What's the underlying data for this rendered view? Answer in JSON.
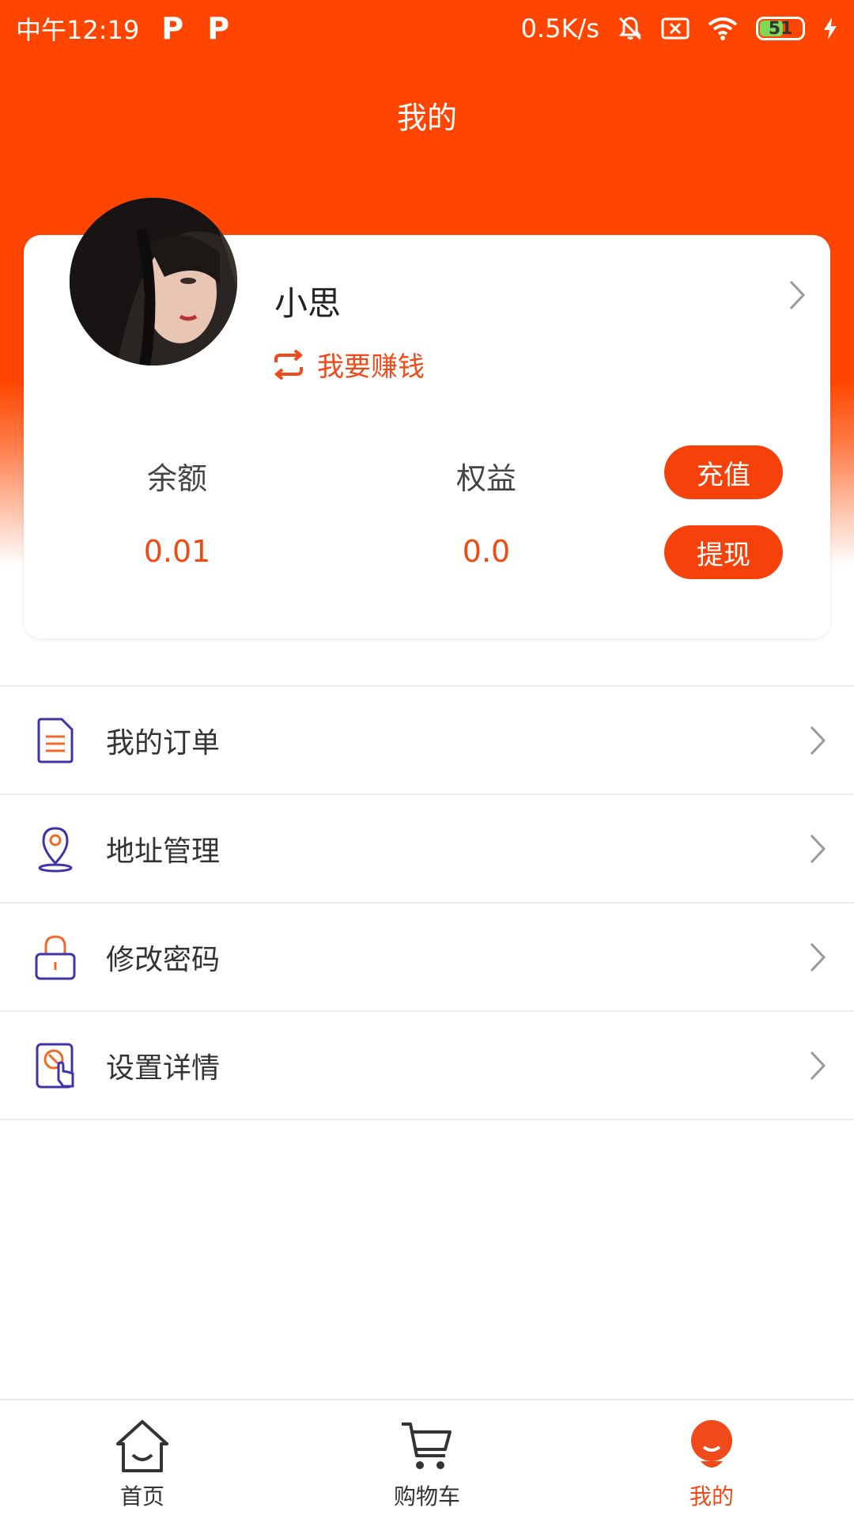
{
  "status_bar": {
    "time": "中午12:19",
    "network_speed": "0.5K/s",
    "battery_level": "51"
  },
  "header": {
    "title": "我的"
  },
  "profile": {
    "name": "小思",
    "earn_label": "我要赚钱"
  },
  "stats": {
    "balance_label": "余额",
    "balance_value": "0.01",
    "equity_label": "权益",
    "equity_value": "0.0",
    "recharge_label": "充值",
    "withdraw_label": "提现"
  },
  "menu": {
    "items": [
      {
        "label": "我的订单",
        "icon": "order-document-icon"
      },
      {
        "label": "地址管理",
        "icon": "location-pin-icon"
      },
      {
        "label": "修改密码",
        "icon": "lock-icon"
      },
      {
        "label": "设置详情",
        "icon": "settings-touch-icon"
      }
    ]
  },
  "tab_bar": {
    "tabs": [
      {
        "label": "首页",
        "icon": "home-icon"
      },
      {
        "label": "购物车",
        "icon": "cart-icon"
      },
      {
        "label": "我的",
        "icon": "profile-face-icon"
      }
    ],
    "active_index": 2
  },
  "colors": {
    "brand": "#ff4500",
    "accent_text": "#ee4a14",
    "icon_purple": "#3f33a8",
    "icon_orange": "#f06a2a"
  }
}
